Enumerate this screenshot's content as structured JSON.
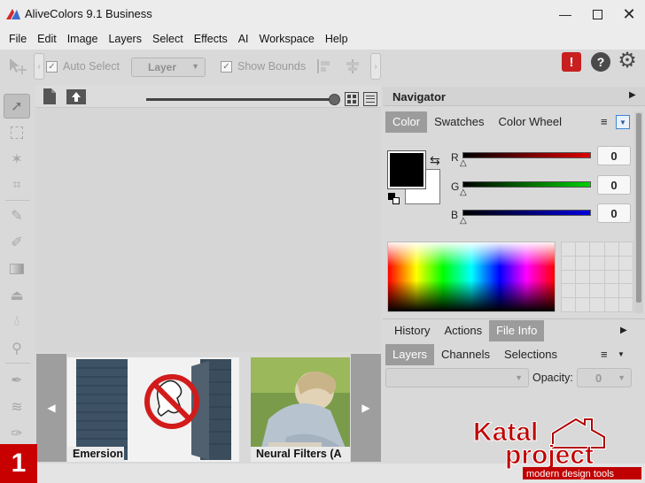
{
  "window": {
    "title": "AliveColors 9.1 Business",
    "controls": [
      "minimize",
      "maximize",
      "close"
    ]
  },
  "menu": [
    "File",
    "Edit",
    "Image",
    "Layers",
    "Select",
    "Effects",
    "AI",
    "Workspace",
    "Help"
  ],
  "options_bar": {
    "auto_select_label": "Auto Select",
    "auto_select_checked": true,
    "layer_mode": "Layer",
    "show_bounds_label": "Show Bounds",
    "show_bounds_checked": true
  },
  "top_icons": [
    "warning-icon",
    "help-icon",
    "settings-icon"
  ],
  "tools": [
    "move-tool",
    "marquee-tool",
    "magic-wand-tool",
    "crop-tool",
    "brush-tool",
    "eraser-tool",
    "gradient-tool",
    "stamp-tool",
    "blur-tool",
    "dodge-tool",
    "pen-tool",
    "smudge-tool",
    "eyedropper-tool"
  ],
  "filmstrip": {
    "items": [
      {
        "label": "Emersion"
      },
      {
        "label": "Neural Filters (A"
      }
    ]
  },
  "navigator": {
    "title": "Navigator"
  },
  "color_panel": {
    "tabs": [
      "Color",
      "Swatches",
      "Color Wheel"
    ],
    "active_tab": "Color",
    "channels": [
      {
        "name": "R",
        "value": "0",
        "color": "#e00000"
      },
      {
        "name": "G",
        "value": "0",
        "color": "#00d000"
      },
      {
        "name": "B",
        "value": "0",
        "color": "#0000e0"
      }
    ],
    "foreground": "#000000",
    "background": "#ffffff"
  },
  "history_panel": {
    "tabs": [
      "History",
      "Actions",
      "File Info"
    ],
    "active_tab": "File Info"
  },
  "layers_panel": {
    "tabs": [
      "Layers",
      "Channels",
      "Selections"
    ],
    "active_tab": "Layers",
    "blend_mode": "",
    "opacity_label": "Opacity:",
    "opacity_value": "0"
  },
  "badge": "1",
  "watermark": {
    "line1": "Katal",
    "line2": "project",
    "tagline": "modern design tools"
  }
}
